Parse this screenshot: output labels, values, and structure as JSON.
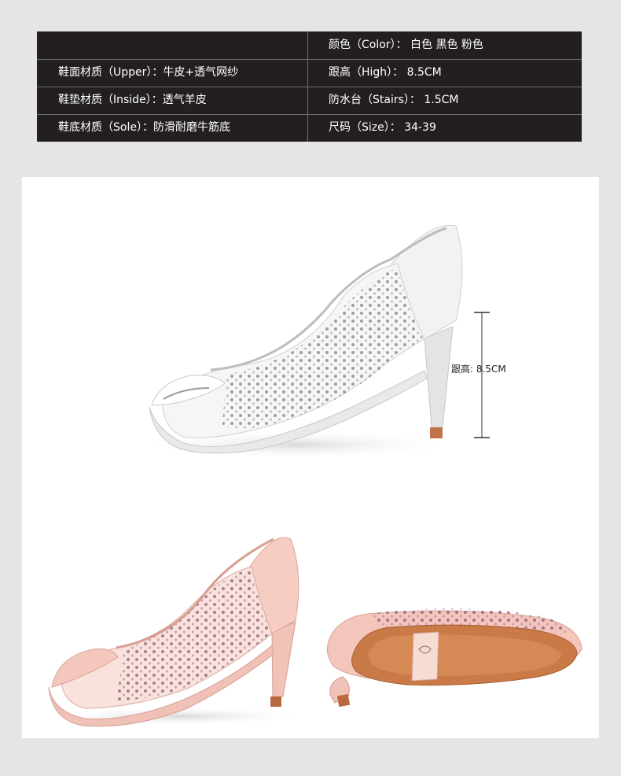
{
  "specs": {
    "color": "颜色（Color）：  白色 黑色 粉色",
    "upper": "鞋面材质（Upper）：牛皮+透气网纱",
    "high": "跟高（High）：  8.5CM",
    "inside": "鞋垫材质（Inside）：透气羊皮",
    "stairs": "防水台（Stairs）：   1.5CM",
    "sole": "鞋底材质（Sole）：防滑耐磨牛筋底",
    "size": "尺码（Size）：   34-39"
  },
  "photo": {
    "heel_label": "跟高: 8.5CM"
  }
}
